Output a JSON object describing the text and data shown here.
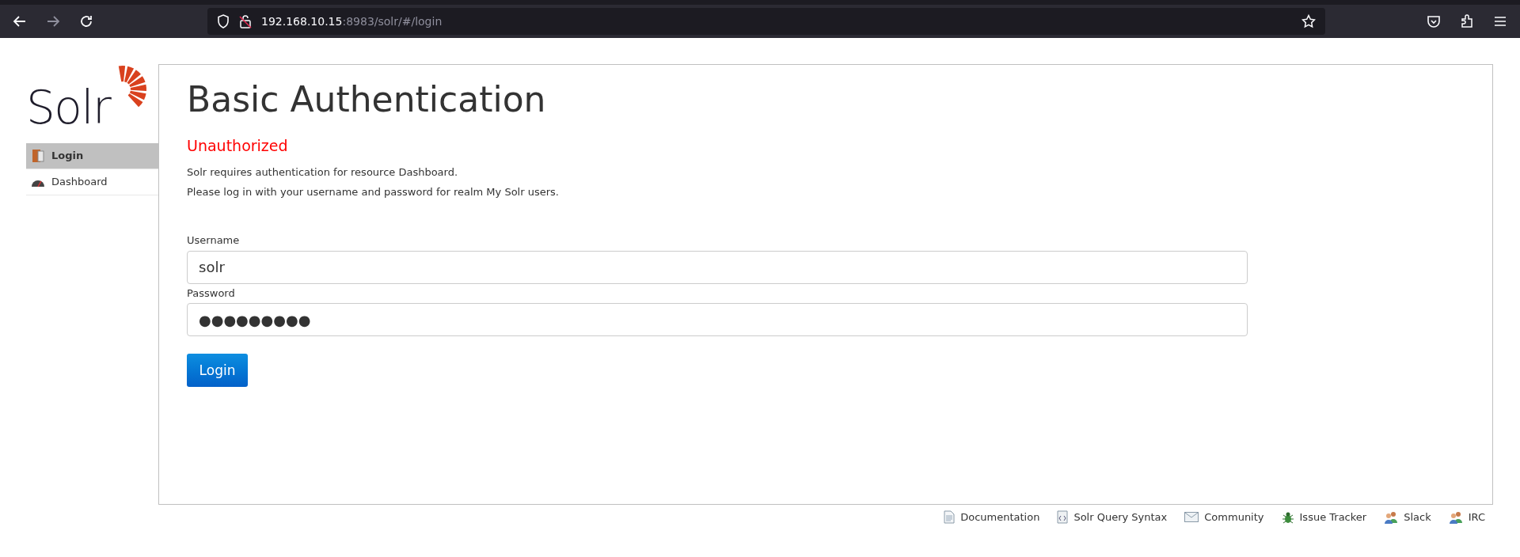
{
  "browser": {
    "url_host": "192.168.10.15",
    "url_rest": ":8983/solr/#/login"
  },
  "logo": {
    "text": "Solr"
  },
  "sidebar": {
    "items": [
      {
        "label": "Login",
        "kind": "door",
        "selected": true
      },
      {
        "label": "Dashboard",
        "kind": "gauge",
        "selected": false
      }
    ]
  },
  "main": {
    "title": "Basic Authentication",
    "error": "Unauthorized",
    "messages": [
      "Solr requires authentication for resource Dashboard.",
      "Please log in with your username and password for realm My Solr users."
    ],
    "fields": [
      {
        "label": "Username",
        "value": "solr"
      },
      {
        "label": "Password",
        "value": "●●●●●●●●●"
      }
    ],
    "button": "Login"
  },
  "footer": {
    "links": [
      {
        "label": "Documentation",
        "kind": "doc"
      },
      {
        "label": "Solr Query Syntax",
        "kind": "code"
      },
      {
        "label": "Community",
        "kind": "mail"
      },
      {
        "label": "Issue Tracker",
        "kind": "bug"
      },
      {
        "label": "Slack",
        "kind": "people"
      },
      {
        "label": "IRC",
        "kind": "people"
      }
    ]
  }
}
